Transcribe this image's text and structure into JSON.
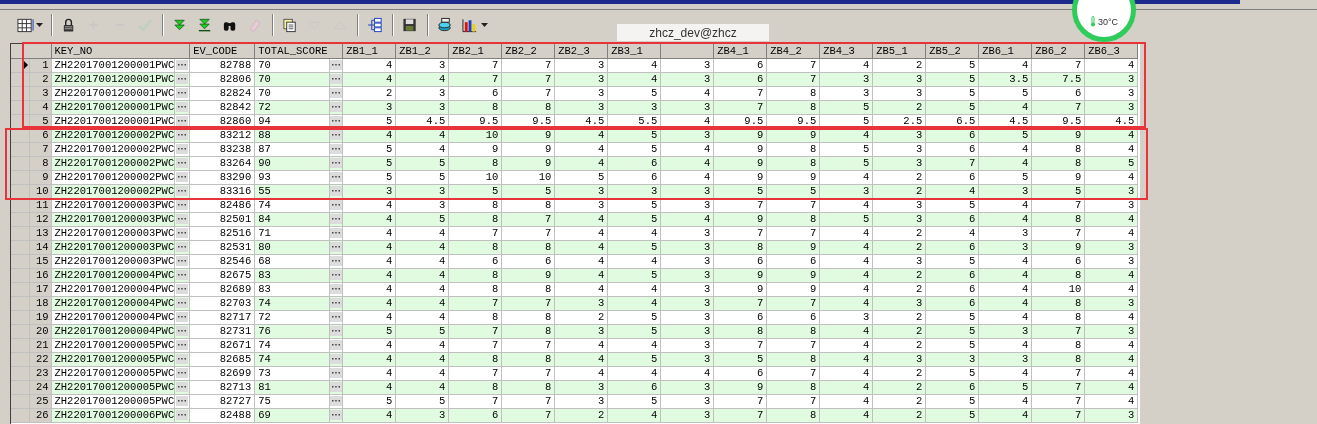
{
  "toolbar": [
    {
      "kind": "grid",
      "disabled": false,
      "dropdown": true
    },
    {
      "kind": "lock",
      "disabled": false,
      "dropdown": false
    },
    {
      "kind": "plus",
      "disabled": true,
      "dropdown": false
    },
    {
      "kind": "minus",
      "disabled": true,
      "dropdown": false
    },
    {
      "kind": "check",
      "disabled": true,
      "dropdown": false
    },
    {
      "kind": "double-down",
      "disabled": false,
      "dropdown": false
    },
    {
      "kind": "down-bottom",
      "disabled": false,
      "dropdown": false
    },
    {
      "kind": "binoculars",
      "disabled": false,
      "dropdown": false
    },
    {
      "kind": "eraser",
      "disabled": true,
      "dropdown": false
    },
    {
      "kind": "documents",
      "disabled": false,
      "dropdown": false
    },
    {
      "kind": "triangle-down",
      "disabled": true,
      "dropdown": false
    },
    {
      "kind": "triangle-up",
      "disabled": true,
      "dropdown": false
    },
    {
      "kind": "tree",
      "disabled": false,
      "dropdown": false
    },
    {
      "kind": "save",
      "disabled": false,
      "dropdown": false
    },
    {
      "kind": "database",
      "disabled": false,
      "dropdown": false
    },
    {
      "kind": "chart",
      "disabled": false,
      "dropdown": true
    }
  ],
  "monitor": {
    "temperature": "30°C"
  },
  "tooltip": "zhcz_dev@zhcz",
  "table": {
    "columns": [
      {
        "label": "KEY_NO"
      },
      {
        "label": "EV_CODE"
      },
      {
        "label": "TOTAL_SCORE"
      },
      {
        "label": "ZB1_1"
      },
      {
        "label": "ZB1_2"
      },
      {
        "label": "ZB2_1"
      },
      {
        "label": "ZB2_2"
      },
      {
        "label": "ZB2_3"
      },
      {
        "label": "ZB3_1"
      },
      {},
      {
        "label": "ZB4_1"
      },
      {
        "label": "ZB4_2"
      },
      {
        "label": "ZB4_3"
      },
      {
        "label": "ZB5_1"
      },
      {
        "label": "ZB5_2"
      },
      {
        "label": "ZB6_1"
      },
      {
        "label": "ZB6_2"
      },
      {
        "label": "ZB6_3"
      }
    ],
    "rows": [
      {
        "n": "1",
        "current": true,
        "key_no": "ZH22017001200001PWC",
        "ev_code": "82788",
        "total_score": "70",
        "scores": [
          "4",
          "3",
          "7",
          "7",
          "3",
          "4",
          "3",
          "6",
          "7",
          "4",
          "2",
          "5",
          "4",
          "7",
          "4"
        ]
      },
      {
        "n": "2",
        "current": false,
        "key_no": "ZH22017001200001PWC",
        "ev_code": "82806",
        "total_score": "70",
        "scores": [
          "4",
          "4",
          "7",
          "7",
          "3",
          "4",
          "3",
          "6",
          "7",
          "3",
          "3",
          "5",
          "3.5",
          "7.5",
          "3"
        ]
      },
      {
        "n": "3",
        "current": false,
        "key_no": "ZH22017001200001PWC",
        "ev_code": "82824",
        "total_score": "70",
        "scores": [
          "2",
          "3",
          "6",
          "7",
          "3",
          "5",
          "4",
          "7",
          "8",
          "3",
          "3",
          "5",
          "5",
          "6",
          "3"
        ]
      },
      {
        "n": "4",
        "current": false,
        "key_no": "ZH22017001200001PWC",
        "ev_code": "82842",
        "total_score": "72",
        "scores": [
          "3",
          "3",
          "8",
          "8",
          "3",
          "3",
          "3",
          "7",
          "8",
          "5",
          "2",
          "5",
          "4",
          "7",
          "3"
        ]
      },
      {
        "n": "5",
        "current": false,
        "key_no": "ZH22017001200001PWC",
        "ev_code": "82860",
        "total_score": "94",
        "scores": [
          "5",
          "4.5",
          "9.5",
          "9.5",
          "4.5",
          "5.5",
          "4",
          "9.5",
          "9.5",
          "5",
          "2.5",
          "6.5",
          "4.5",
          "9.5",
          "4.5"
        ]
      },
      {
        "n": "6",
        "current": false,
        "key_no": "ZH22017001200002PWC",
        "ev_code": "83212",
        "total_score": "88",
        "scores": [
          "4",
          "4",
          "10",
          "9",
          "4",
          "5",
          "3",
          "9",
          "9",
          "4",
          "3",
          "6",
          "5",
          "9",
          "4"
        ]
      },
      {
        "n": "7",
        "current": false,
        "key_no": "ZH22017001200002PWC",
        "ev_code": "83238",
        "total_score": "87",
        "scores": [
          "5",
          "4",
          "9",
          "9",
          "4",
          "5",
          "4",
          "9",
          "8",
          "5",
          "3",
          "6",
          "4",
          "8",
          "4"
        ]
      },
      {
        "n": "8",
        "current": false,
        "key_no": "ZH22017001200002PWC",
        "ev_code": "83264",
        "total_score": "90",
        "scores": [
          "5",
          "5",
          "8",
          "9",
          "4",
          "6",
          "4",
          "9",
          "8",
          "5",
          "3",
          "7",
          "4",
          "8",
          "5"
        ]
      },
      {
        "n": "9",
        "current": false,
        "key_no": "ZH22017001200002PWC",
        "ev_code": "83290",
        "total_score": "93",
        "scores": [
          "5",
          "5",
          "10",
          "10",
          "5",
          "6",
          "4",
          "9",
          "9",
          "4",
          "2",
          "6",
          "5",
          "9",
          "4"
        ]
      },
      {
        "n": "10",
        "current": false,
        "key_no": "ZH22017001200002PWC",
        "ev_code": "83316",
        "total_score": "55",
        "scores": [
          "3",
          "3",
          "5",
          "5",
          "3",
          "3",
          "3",
          "5",
          "5",
          "3",
          "2",
          "4",
          "3",
          "5",
          "3"
        ]
      },
      {
        "n": "11",
        "current": false,
        "key_no": "ZH22017001200003PWC",
        "ev_code": "82486",
        "total_score": "74",
        "scores": [
          "4",
          "3",
          "8",
          "8",
          "3",
          "5",
          "3",
          "7",
          "7",
          "4",
          "3",
          "5",
          "4",
          "7",
          "3"
        ]
      },
      {
        "n": "12",
        "current": false,
        "key_no": "ZH22017001200003PWC",
        "ev_code": "82501",
        "total_score": "84",
        "scores": [
          "4",
          "5",
          "8",
          "7",
          "4",
          "5",
          "4",
          "9",
          "8",
          "5",
          "3",
          "6",
          "4",
          "8",
          "4"
        ]
      },
      {
        "n": "13",
        "current": false,
        "key_no": "ZH22017001200003PWC",
        "ev_code": "82516",
        "total_score": "71",
        "scores": [
          "4",
          "4",
          "7",
          "7",
          "4",
          "4",
          "3",
          "7",
          "7",
          "4",
          "2",
          "4",
          "3",
          "7",
          "4"
        ]
      },
      {
        "n": "14",
        "current": false,
        "key_no": "ZH22017001200003PWC",
        "ev_code": "82531",
        "total_score": "80",
        "scores": [
          "4",
          "4",
          "8",
          "8",
          "4",
          "5",
          "3",
          "8",
          "9",
          "4",
          "2",
          "6",
          "3",
          "9",
          "3"
        ]
      },
      {
        "n": "15",
        "current": false,
        "key_no": "ZH22017001200003PWC",
        "ev_code": "82546",
        "total_score": "68",
        "scores": [
          "4",
          "4",
          "6",
          "6",
          "4",
          "4",
          "3",
          "6",
          "6",
          "4",
          "3",
          "5",
          "4",
          "6",
          "3"
        ]
      },
      {
        "n": "16",
        "current": false,
        "key_no": "ZH22017001200004PWC",
        "ev_code": "82675",
        "total_score": "83",
        "scores": [
          "4",
          "4",
          "8",
          "9",
          "4",
          "5",
          "3",
          "9",
          "9",
          "4",
          "2",
          "6",
          "4",
          "8",
          "4"
        ]
      },
      {
        "n": "17",
        "current": false,
        "key_no": "ZH22017001200004PWC",
        "ev_code": "82689",
        "total_score": "83",
        "scores": [
          "4",
          "4",
          "8",
          "8",
          "4",
          "4",
          "3",
          "9",
          "9",
          "4",
          "2",
          "6",
          "4",
          "10",
          "4"
        ]
      },
      {
        "n": "18",
        "current": false,
        "key_no": "ZH22017001200004PWC",
        "ev_code": "82703",
        "total_score": "74",
        "scores": [
          "4",
          "4",
          "7",
          "7",
          "3",
          "4",
          "3",
          "7",
          "7",
          "4",
          "3",
          "6",
          "4",
          "8",
          "3"
        ]
      },
      {
        "n": "19",
        "current": false,
        "key_no": "ZH22017001200004PWC",
        "ev_code": "82717",
        "total_score": "72",
        "scores": [
          "4",
          "4",
          "8",
          "8",
          "2",
          "5",
          "3",
          "6",
          "6",
          "3",
          "2",
          "5",
          "4",
          "8",
          "4"
        ]
      },
      {
        "n": "20",
        "current": false,
        "key_no": "ZH22017001200004PWC",
        "ev_code": "82731",
        "total_score": "76",
        "scores": [
          "5",
          "5",
          "7",
          "8",
          "3",
          "5",
          "3",
          "8",
          "8",
          "4",
          "2",
          "5",
          "3",
          "7",
          "3"
        ]
      },
      {
        "n": "21",
        "current": false,
        "key_no": "ZH22017001200005PWC",
        "ev_code": "82671",
        "total_score": "74",
        "scores": [
          "4",
          "4",
          "7",
          "7",
          "4",
          "4",
          "3",
          "7",
          "7",
          "4",
          "2",
          "5",
          "4",
          "8",
          "4"
        ]
      },
      {
        "n": "22",
        "current": false,
        "key_no": "ZH22017001200005PWC",
        "ev_code": "82685",
        "total_score": "74",
        "scores": [
          "4",
          "4",
          "8",
          "8",
          "4",
          "5",
          "3",
          "5",
          "8",
          "4",
          "3",
          "3",
          "3",
          "8",
          "4"
        ]
      },
      {
        "n": "23",
        "current": false,
        "key_no": "ZH22017001200005PWC",
        "ev_code": "82699",
        "total_score": "73",
        "scores": [
          "4",
          "4",
          "7",
          "7",
          "4",
          "4",
          "4",
          "6",
          "7",
          "4",
          "2",
          "5",
          "4",
          "7",
          "4"
        ]
      },
      {
        "n": "24",
        "current": false,
        "key_no": "ZH22017001200005PWC",
        "ev_code": "82713",
        "total_score": "81",
        "scores": [
          "4",
          "4",
          "8",
          "8",
          "3",
          "6",
          "3",
          "9",
          "8",
          "4",
          "2",
          "6",
          "5",
          "7",
          "4"
        ]
      },
      {
        "n": "25",
        "current": false,
        "key_no": "ZH22017001200005PWC",
        "ev_code": "82727",
        "total_score": "75",
        "scores": [
          "5",
          "5",
          "7",
          "7",
          "3",
          "5",
          "3",
          "7",
          "7",
          "4",
          "2",
          "5",
          "4",
          "7",
          "4"
        ]
      },
      {
        "n": "26",
        "current": false,
        "key_no": "ZH22017001200006PWC",
        "ev_code": "82488",
        "total_score": "69",
        "scores": [
          "4",
          "3",
          "6",
          "7",
          "2",
          "4",
          "3",
          "7",
          "8",
          "4",
          "2",
          "5",
          "4",
          "7",
          "3"
        ]
      }
    ]
  }
}
